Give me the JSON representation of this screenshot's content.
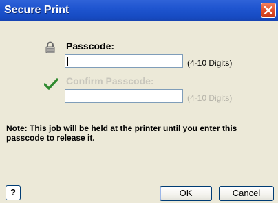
{
  "window": {
    "title": "Secure Print"
  },
  "icons": {
    "close": "close-icon",
    "lock": "lock-icon",
    "check": "checkmark-icon"
  },
  "form": {
    "passcode_label": "Passcode:",
    "passcode_value": "",
    "passcode_hint": "(4-10 Digits)",
    "confirm_label": "Confirm Passcode:",
    "confirm_value": "",
    "confirm_hint": "(4-10 Digits)"
  },
  "note": "Note:  This job will be held at the printer until you enter this passcode to release it.",
  "buttons": {
    "help": "?",
    "ok": "OK",
    "cancel": "Cancel"
  }
}
